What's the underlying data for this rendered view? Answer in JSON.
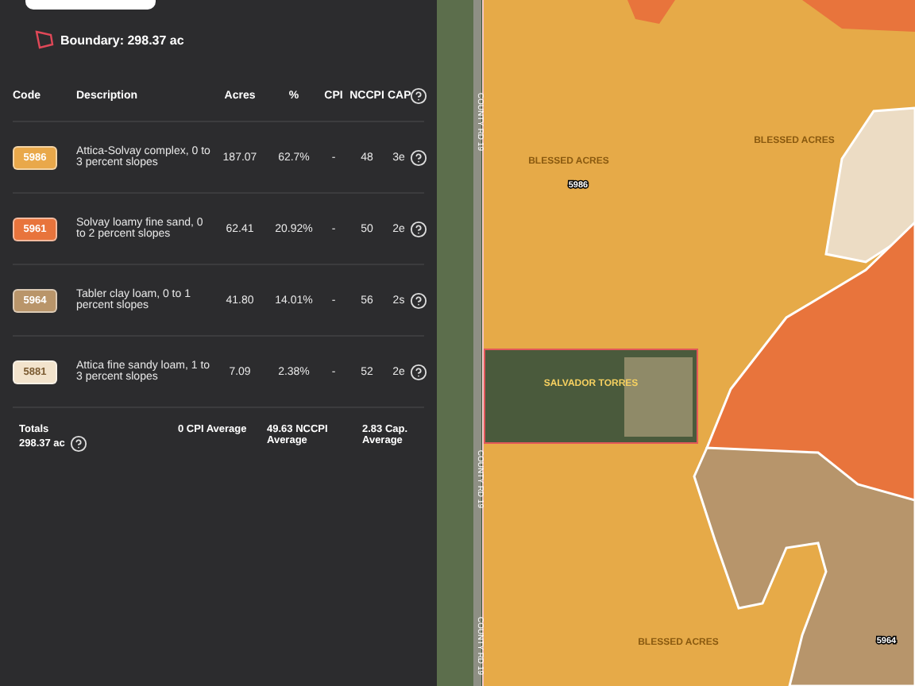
{
  "boundary": {
    "label": "Boundary: 298.37 ac"
  },
  "table": {
    "columns": [
      "Code",
      "Description",
      "Acres",
      "%",
      "CPI",
      "NCCPI",
      "CAP"
    ],
    "rows": [
      {
        "code": "5986",
        "color": "#e9a84a",
        "description": "Attica-Solvay complex, 0 to 3 percent slopes",
        "acres": "187.07",
        "percent": "62.7%",
        "cpi": "-",
        "nccpi": "48",
        "cap": "3e"
      },
      {
        "code": "5961",
        "color": "#e8743c",
        "description": "Solvay loamy fine sand, 0 to 2 percent slopes",
        "acres": "62.41",
        "percent": "20.92%",
        "cpi": "-",
        "nccpi": "50",
        "cap": "2e"
      },
      {
        "code": "5964",
        "color": "#b9956a",
        "description": "Tabler clay loam, 0 to 1 percent slopes",
        "acres": "41.80",
        "percent": "14.01%",
        "cpi": "-",
        "nccpi": "56",
        "cap": "2s"
      },
      {
        "code": "5881",
        "color": "#f2e3cc",
        "description": "Attica fine sandy loam, 1 to 3 percent slopes",
        "acres": "7.09",
        "percent": "2.38%",
        "cpi": "-",
        "nccpi": "52",
        "cap": "2e"
      }
    ]
  },
  "totals": {
    "label": "Totals",
    "value": "298.37 ac",
    "cpi": "0 CPI Average",
    "nccpi": "49.63 NCCPI Average",
    "cap": "2.83 Cap. Average"
  },
  "map": {
    "road_labels": [
      "COUNTY RD 19",
      "COUNTY RD 19",
      "COUNTY RD 19"
    ],
    "field_labels": [
      "BLESSED ACRES",
      "BLESSED ACRES",
      "SALVADOR TORRES",
      "BLESSED ACRES"
    ],
    "soil_labels": [
      "5986",
      "5964"
    ]
  }
}
